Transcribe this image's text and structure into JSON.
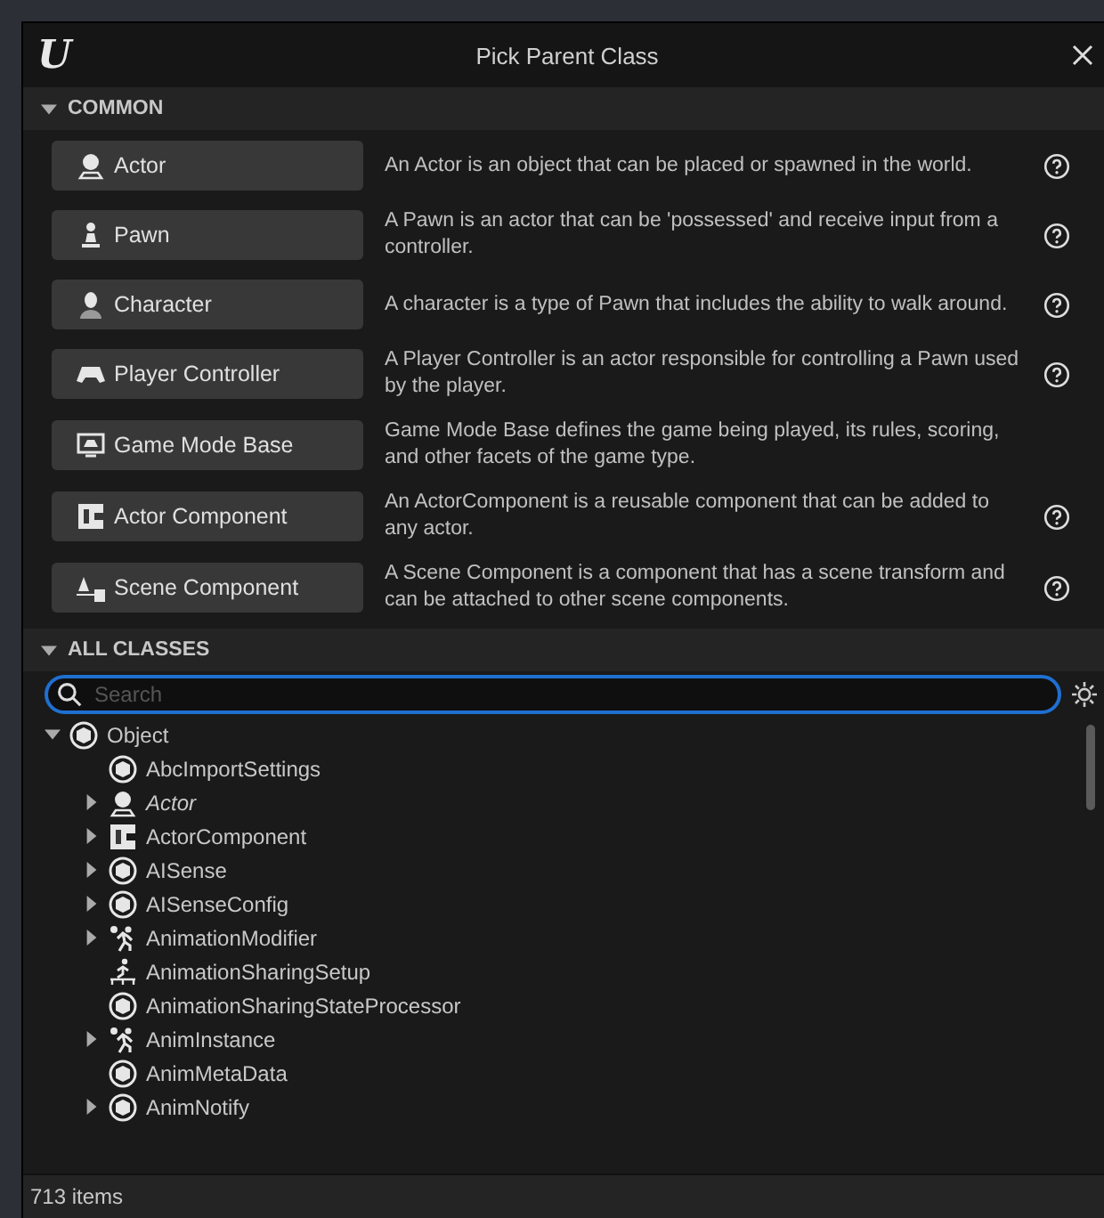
{
  "window": {
    "logo": "U",
    "title": "Pick Parent Class"
  },
  "common": {
    "title": "COMMON",
    "expanded": true,
    "items": [
      {
        "label": "Actor",
        "kind": "actor",
        "description": "An Actor is an object that can be placed or spawned in the world.",
        "help": true
      },
      {
        "label": "Pawn",
        "kind": "pawn",
        "description": "A Pawn is an actor that can be 'possessed' and receive input from a controller.",
        "help": true
      },
      {
        "label": "Character",
        "kind": "character",
        "description": "A character is a type of Pawn that includes the ability to walk around.",
        "help": true
      },
      {
        "label": "Player Controller",
        "kind": "controller",
        "description": "A Player Controller is an actor responsible for controlling a Pawn used by the player.",
        "help": true
      },
      {
        "label": "Game Mode Base",
        "kind": "gamemode",
        "description": "Game Mode Base defines the game being played, its rules, scoring, and other facets of the game type.",
        "help": false
      },
      {
        "label": "Actor Component",
        "kind": "component",
        "description": "An ActorComponent is a reusable component that can be added to any actor.",
        "help": true
      },
      {
        "label": "Scene Component",
        "kind": "scene",
        "description": "A Scene Component is a component that has a scene transform and can be attached to other scene components.",
        "help": true
      }
    ]
  },
  "all_classes": {
    "title": "ALL CLASSES",
    "expanded": true,
    "search": {
      "placeholder": "Search"
    },
    "tree": [
      {
        "label": "Object",
        "kind": "object",
        "expanded": true,
        "children": [
          {
            "label": "AbcImportSettings",
            "kind": "object",
            "expandable": false,
            "italic": false
          },
          {
            "label": "Actor",
            "kind": "actor",
            "expandable": true,
            "italic": true
          },
          {
            "label": "ActorComponent",
            "kind": "component",
            "expandable": true,
            "italic": false
          },
          {
            "label": "AISense",
            "kind": "object",
            "expandable": true,
            "italic": false
          },
          {
            "label": "AISenseConfig",
            "kind": "object",
            "expandable": true,
            "italic": false
          },
          {
            "label": "AnimationModifier",
            "kind": "anim",
            "expandable": true,
            "italic": false
          },
          {
            "label": "AnimationSharingSetup",
            "kind": "sharing",
            "expandable": false,
            "italic": false
          },
          {
            "label": "AnimationSharingStateProcessor",
            "kind": "object",
            "expandable": false,
            "italic": false
          },
          {
            "label": "AnimInstance",
            "kind": "anim",
            "expandable": true,
            "italic": false
          },
          {
            "label": "AnimMetaData",
            "kind": "object",
            "expandable": false,
            "italic": false
          },
          {
            "label": "AnimNotify",
            "kind": "object",
            "expandable": true,
            "italic": false
          }
        ]
      }
    ]
  },
  "status_bar": {
    "text": "713 items"
  }
}
